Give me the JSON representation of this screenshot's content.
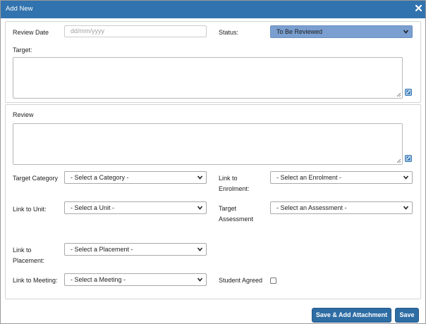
{
  "dialog": {
    "title": "Add New"
  },
  "section1": {
    "review_date_label": "Review Date",
    "review_date_placeholder": "dd/mm/yyyy",
    "status_label": "Status:",
    "status_value": "To Be Reviewed",
    "target_label": "Target:"
  },
  "section2": {
    "review_label": "Review",
    "target_category_label": "Target Category",
    "target_category_value": "- Select a Category -",
    "link_enrolment_label_1": "Link to",
    "link_enrolment_label_2": "Enrolment:",
    "enrolment_value": "- Select an Enrolment -",
    "link_unit_label": "Link to Unit:",
    "unit_value": "- Select a Unit -",
    "target_assessment_label_1": "Target",
    "target_assessment_label_2": "Assessment",
    "assessment_value": "- Select an Assessment -",
    "link_placement_label_1": "Link to",
    "link_placement_label_2": "Placement:",
    "placement_value": "- Select a Placement -",
    "link_meeting_label": "Link to Meeting:",
    "meeting_value": "- Select a Meeting -",
    "student_agreed_label": "Student Agreed"
  },
  "footer": {
    "save_attachment_label": "Save & Add Attachment",
    "save_label": "Save"
  },
  "colors": {
    "titlebar": "#3173ae",
    "status_select": "#7a9fd0",
    "primary_button": "#2e6da4"
  },
  "icons": {
    "close": "close-icon",
    "edit": "edit-icon",
    "chevron": "chevron-down-icon"
  }
}
